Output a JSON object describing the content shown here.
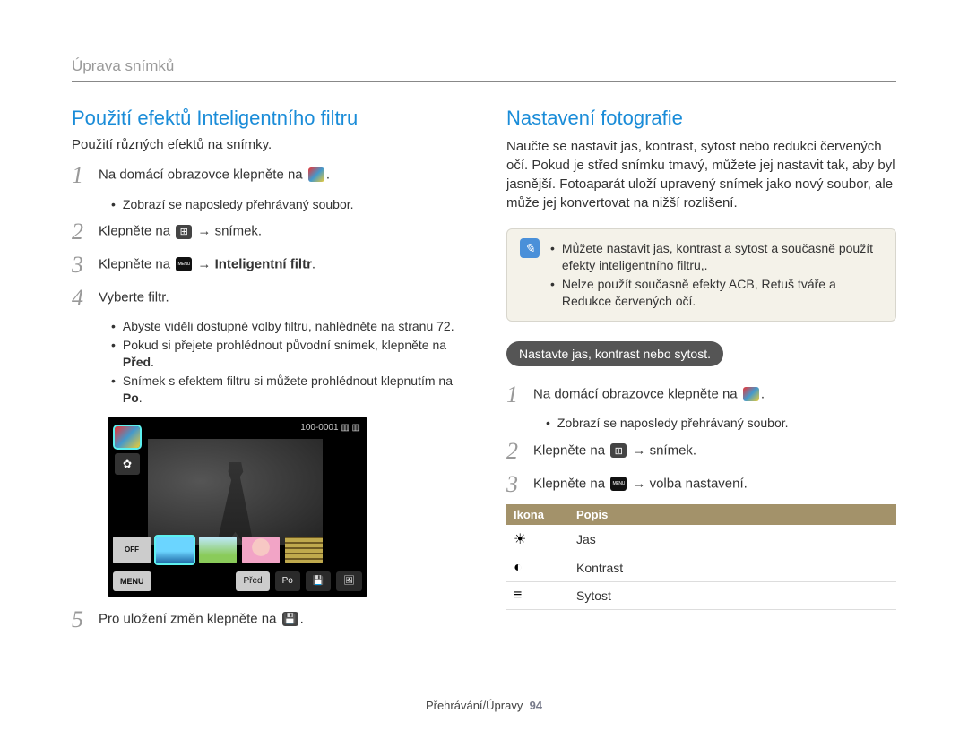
{
  "page_header": "Úprava snímků",
  "footer": {
    "text": "Přehrávání/Úpravy",
    "page_num": "94"
  },
  "left": {
    "title": "Použití efektů Inteligentního filtru",
    "subtitle": "Použití různých efektů na snímky.",
    "step1a": "Na domácí obrazovce klepněte na ",
    "step1_bullet": "Zobrazí se naposledy přehrávaný soubor.",
    "step2a": "Klepněte na ",
    "step2b": " → snímek.",
    "step3a": "Klepněte na ",
    "step3b": " → ",
    "step3c": "Inteligentní filtr",
    "step4": "Vyberte filtr.",
    "step4_bullets": [
      "Abyste viděli dostupné volby filtru, nahlédněte na stranu 72.",
      "Pokud si přejete prohlédnout původní snímek, klepněte na ",
      "Snímek s efektem filtru si můžete prohlédnout klepnutím na "
    ],
    "pred": "Před",
    "po": "Po",
    "step5a": "Pro uložení změn klepněte na ",
    "screenshot": {
      "counter": "100-0001",
      "off_label": "OFF",
      "menu_label": "MENU",
      "pred_label": "Před",
      "po_label": "Po"
    }
  },
  "right": {
    "title": "Nastavení fotografie",
    "intro": "Naučte se nastavit jas, kontrast, sytost nebo redukci červených očí. Pokud je střed snímku tmavý, můžete jej nastavit tak, aby byl jasnější. Fotoaparát uloží upravený snímek jako nový soubor, ale může jej konvertovat na nižší rozlišení.",
    "note_items": [
      "Můžete nastavit jas, kontrast a sytost a současně použít efekty inteligentního filtru,.",
      "Nelze použít současně efekty ACB, Retuš tváře a Redukce červených očí."
    ],
    "pill": "Nastavte jas, kontrast nebo sytost.",
    "step1a": "Na domácí obrazovce klepněte na ",
    "step1_bullet": "Zobrazí se naposledy přehrávaný soubor.",
    "step2a": "Klepněte na ",
    "step2b": " → snímek.",
    "step3a": "Klepněte na ",
    "step3b": " → volba nastavení.",
    "table": {
      "h1": "Ikona",
      "h2": "Popis",
      "rows": [
        {
          "icon": "sun",
          "label": "Jas"
        },
        {
          "icon": "half",
          "label": "Kontrast"
        },
        {
          "icon": "bars",
          "label": "Sytost"
        }
      ]
    }
  },
  "chart_data": {
    "type": "table",
    "columns": [
      "Ikona",
      "Popis"
    ],
    "rows": [
      {
        "Ikona": "brightness-icon",
        "Popis": "Jas"
      },
      {
        "Ikona": "contrast-icon",
        "Popis": "Kontrast"
      },
      {
        "Ikona": "saturation-icon",
        "Popis": "Sytost"
      }
    ]
  }
}
